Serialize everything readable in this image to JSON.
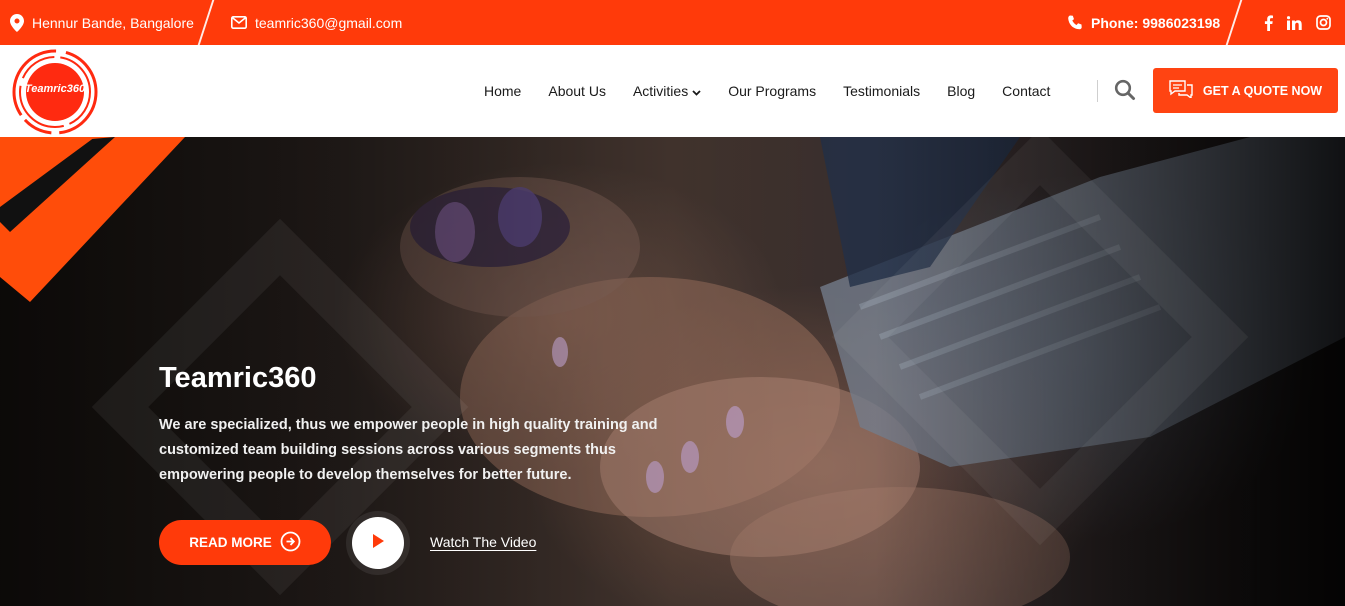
{
  "topbar": {
    "address": "Hennur Bande, Bangalore",
    "email": "teamric360@gmail.com",
    "phone": "Phone: 9986023198",
    "social": [
      "facebook-icon",
      "linkedin-icon",
      "instagram-icon"
    ]
  },
  "header": {
    "logo_text": "Teamric360",
    "nav": [
      {
        "label": "Home"
      },
      {
        "label": "About Us"
      },
      {
        "label": "Activities"
      },
      {
        "label": "Our Programs"
      },
      {
        "label": "Testimonials"
      },
      {
        "label": "Blog"
      },
      {
        "label": "Contact"
      }
    ],
    "quote_button": "GET A QUOTE NOW"
  },
  "hero": {
    "title": "Teamric360",
    "description": "We are specialized, thus we empower people in high quality training and customized team building sessions across various segments thus empowering people to develop themselves for better future.",
    "read_more": "READ MORE",
    "watch_video": "Watch The Video"
  },
  "colors": {
    "accent": "#ff3a0a",
    "white": "#ffffff",
    "text": "#1a1a1a"
  }
}
